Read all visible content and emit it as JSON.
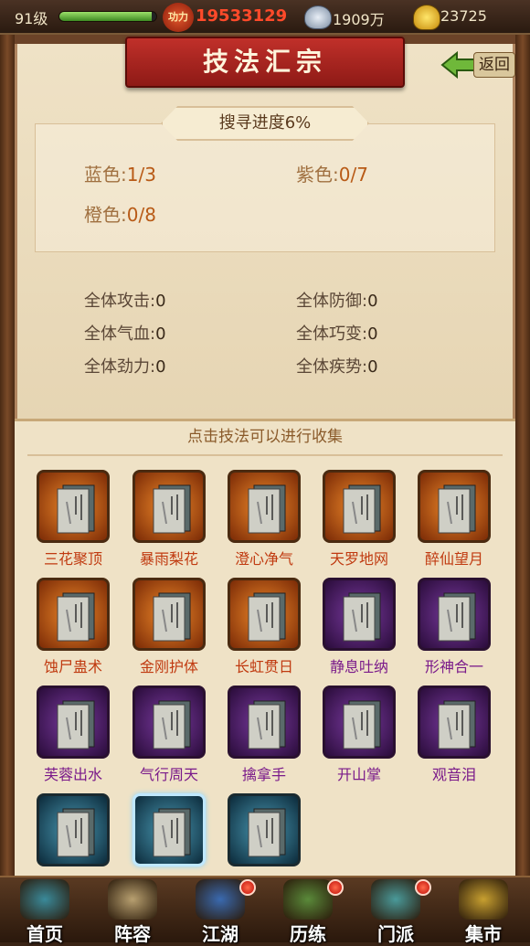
{
  "topbar": {
    "level": "91级",
    "exp_fraction": 0.95,
    "power_icon_text": "功力",
    "power": "19533129",
    "silver": "1909万",
    "gold": "23725"
  },
  "title": "技法汇宗",
  "back_label": "返回",
  "progress": {
    "label": "搜寻进度6%",
    "blue_label": "蓝色:",
    "blue_value": "1/3",
    "purple_label": "紫色:",
    "purple_value": "0/7",
    "orange_label": "橙色:",
    "orange_value": "0/8"
  },
  "attributes": [
    {
      "label": "全体攻击:",
      "value": "0"
    },
    {
      "label": "全体防御:",
      "value": "0"
    },
    {
      "label": "全体气血:",
      "value": "0"
    },
    {
      "label": "全体巧变:",
      "value": "0"
    },
    {
      "label": "全体劲力:",
      "value": "0"
    },
    {
      "label": "全体疾势:",
      "value": "0"
    }
  ],
  "hint": "点击技法可以进行收集",
  "skills": [
    {
      "name": "三花聚顶",
      "rarity": "orange"
    },
    {
      "name": "暴雨梨花",
      "rarity": "orange"
    },
    {
      "name": "澄心净气",
      "rarity": "orange"
    },
    {
      "name": "天罗地网",
      "rarity": "orange"
    },
    {
      "name": "醉仙望月",
      "rarity": "orange"
    },
    {
      "name": "蚀尸蛊术",
      "rarity": "orange"
    },
    {
      "name": "金刚护体",
      "rarity": "orange"
    },
    {
      "name": "长虹贯日",
      "rarity": "orange"
    },
    {
      "name": "静息吐纳",
      "rarity": "purple"
    },
    {
      "name": "形神合一",
      "rarity": "purple"
    },
    {
      "name": "芙蓉出水",
      "rarity": "purple"
    },
    {
      "name": "气行周天",
      "rarity": "purple"
    },
    {
      "name": "擒拿手",
      "rarity": "purple"
    },
    {
      "name": "开山掌",
      "rarity": "purple"
    },
    {
      "name": "观音泪",
      "rarity": "purple"
    },
    {
      "name": "",
      "rarity": "blue"
    },
    {
      "name": "",
      "rarity": "blue",
      "selected": true
    },
    {
      "name": "",
      "rarity": "blue"
    }
  ],
  "nav": [
    {
      "label": "首页",
      "icon": "home-icon",
      "badge": false
    },
    {
      "label": "阵容",
      "icon": "formation-icon",
      "badge": false
    },
    {
      "label": "江湖",
      "icon": "jianghu-icon",
      "badge": true
    },
    {
      "label": "历练",
      "icon": "training-icon",
      "badge": true
    },
    {
      "label": "门派",
      "icon": "sect-icon",
      "badge": true
    },
    {
      "label": "集市",
      "icon": "market-icon",
      "badge": false
    }
  ],
  "colors": {
    "orange_text": "#c03a10",
    "purple_text": "#7a1a8a",
    "banner_red": "#b0261f"
  }
}
